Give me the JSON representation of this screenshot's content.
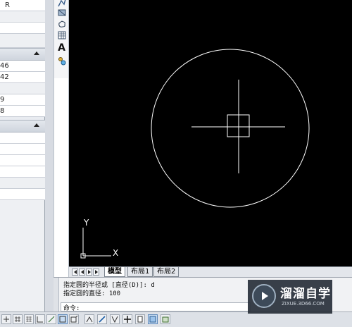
{
  "properties_panel": {
    "rows": [
      {
        "text": "R"
      },
      {
        "text": ""
      },
      {
        "text": ""
      },
      {
        "text": "46"
      },
      {
        "text": "42"
      },
      {
        "text": ""
      },
      {
        "text": "9"
      },
      {
        "text": "8"
      }
    ]
  },
  "vertical_toolbar": {
    "icons": [
      "polyline-edit-icon",
      "region-icon",
      "revcloud-icon",
      "table-icon",
      "multiline-text-icon",
      "add-selected-icon"
    ],
    "text_tool_glyph": "A"
  },
  "canvas": {
    "background": "#000000",
    "stroke": "#ffffff",
    "ucs": {
      "y_label": "Y",
      "x_label": "X"
    }
  },
  "layout_tabs": {
    "tabs": [
      {
        "label": "模型",
        "active": true
      },
      {
        "label": "布局1",
        "active": false
      },
      {
        "label": "布局2",
        "active": false
      }
    ]
  },
  "command_window": {
    "history": [
      "指定圆的半径或 [直径(D)]: d",
      "指定圆的直径: 100"
    ],
    "prompt": "命令:"
  },
  "status_bar": {
    "buttons": [
      "snap-mode",
      "grid-display",
      "ortho-mode",
      "polar-tracking",
      "object-snap",
      "object-snap-tracking",
      "dynamic-ucs",
      "dynamic-input",
      "lineweight",
      "quick-properties",
      "selection-cycling"
    ]
  },
  "watermark": {
    "title": "溜溜自学",
    "url": "ZIXUE.3D66.COM"
  }
}
